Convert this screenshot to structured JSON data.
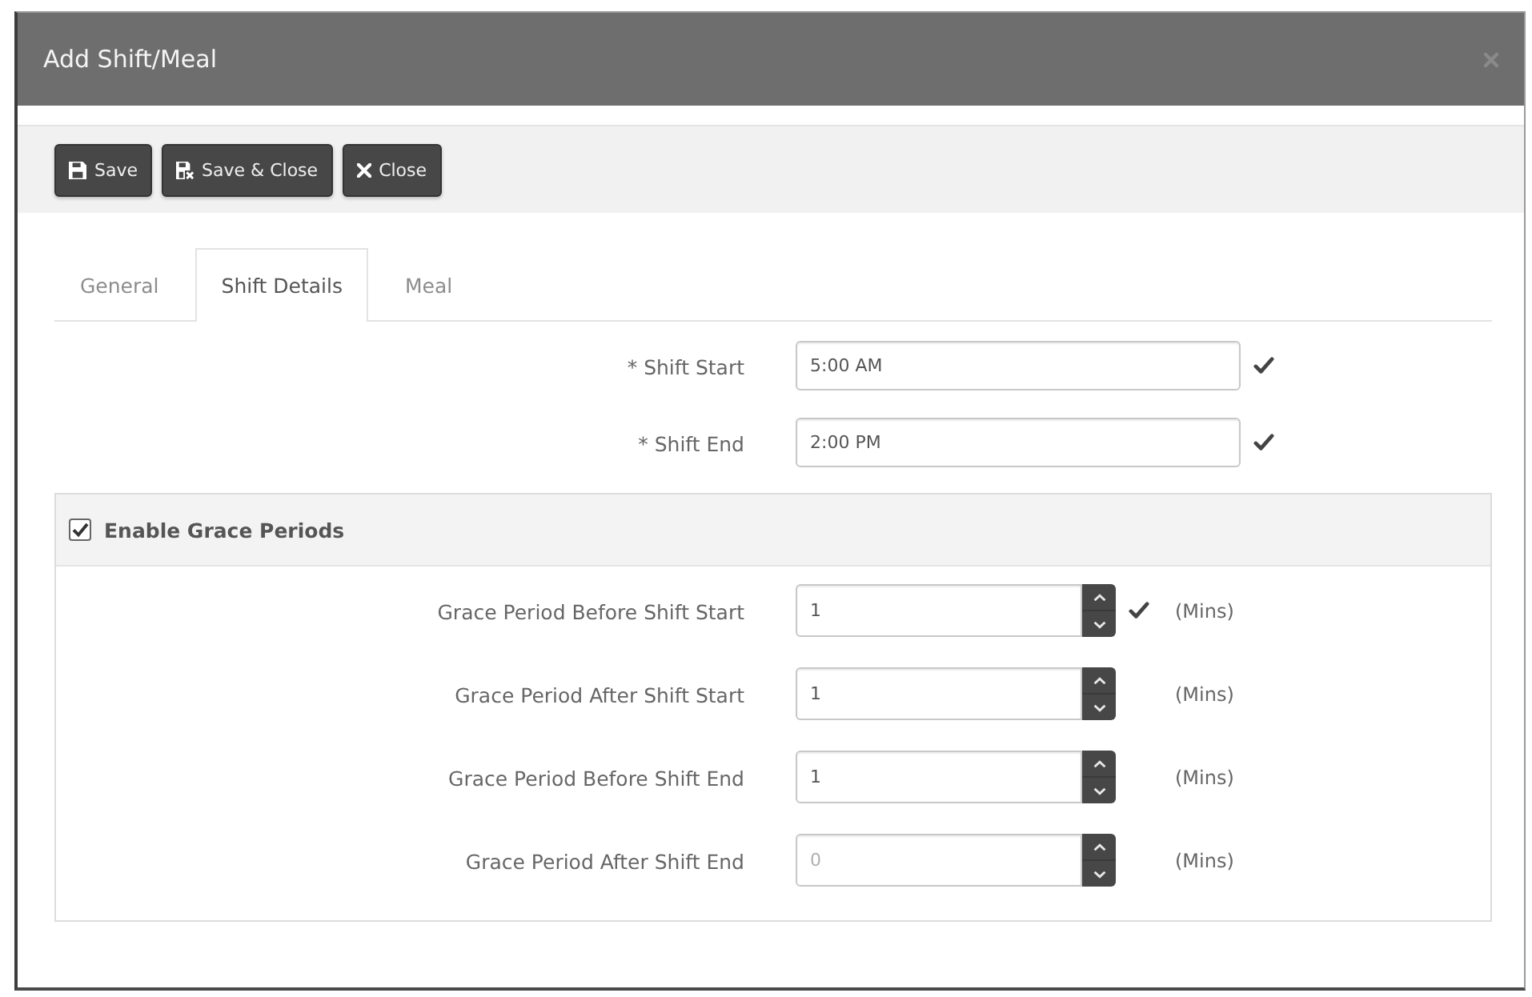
{
  "window": {
    "title": "Add Shift/Meal"
  },
  "toolbar": [
    {
      "kind": "save",
      "label": "Save"
    },
    {
      "kind": "save_close",
      "label": "Save & Close"
    },
    {
      "kind": "close",
      "label": "Close"
    }
  ],
  "tabs": [
    {
      "label": "General",
      "selected": false
    },
    {
      "label": "Shift Details",
      "selected": true
    },
    {
      "label": "Meal",
      "selected": false
    }
  ],
  "shift_fields": [
    {
      "label": "* Shift Start",
      "value": "5:00 AM",
      "valid": true
    },
    {
      "label": "* Shift End",
      "value": "2:00 PM",
      "valid": true
    }
  ],
  "grace_periods": {
    "label": "Enable Grace Periods",
    "checked": true,
    "fields": [
      {
        "label": "Grace Period Before Shift Start",
        "value": "1",
        "valid": true,
        "unit": "(Mins)"
      },
      {
        "label": "Grace Period After Shift Start",
        "value": "1",
        "valid": false,
        "unit": "(Mins)"
      },
      {
        "label": "Grace Period Before Shift End",
        "value": "1",
        "valid": false,
        "unit": "(Mins)"
      },
      {
        "label": "Grace Period After Shift End",
        "placeholder": "0",
        "valid": false,
        "unit": "(Mins)"
      }
    ]
  }
}
